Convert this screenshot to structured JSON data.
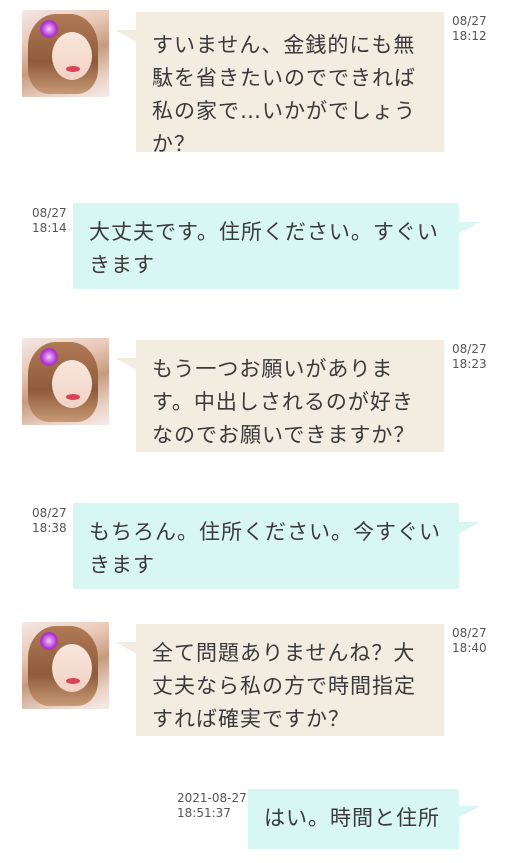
{
  "messages": [
    {
      "side": "in",
      "text": "すいません、金銭的にも無駄を省きたいのでできれば私の家で…いかがでしょうか？",
      "date": "08/27",
      "time": "18:12"
    },
    {
      "side": "out",
      "text": "大丈夫です。住所ください。すぐいきます",
      "date": "08/27",
      "time": "18:14"
    },
    {
      "side": "in",
      "text": "もう一つお願いがあります。中出しされるのが好きなのでお願いできますか？",
      "date": "08/27",
      "time": "18:23"
    },
    {
      "side": "out",
      "text": "もちろん。住所ください。今すぐいきます",
      "date": "08/27",
      "time": "18:38"
    },
    {
      "side": "in",
      "text": "全て問題ありませんね？大丈夫なら私の方で時間指定すれば確実ですか？",
      "date": "08/27",
      "time": "18:40"
    },
    {
      "side": "out",
      "text": "はい。時間と住所",
      "date": "2021-08-27",
      "time": "18:51:37"
    }
  ],
  "colors": {
    "incoming_bubble": "#f2ece1",
    "outgoing_bubble": "#d8f6f2",
    "background": "#ffffff"
  }
}
